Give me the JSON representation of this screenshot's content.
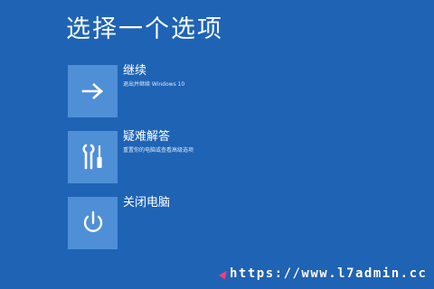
{
  "screen": {
    "title": "选择一个选项",
    "background": "#1f63b5",
    "tile_color": "#4f8fd6"
  },
  "options": [
    {
      "label": "继续",
      "description": "退出并继续 Windows 10",
      "icon": "arrow-right-icon"
    },
    {
      "label": "疑难解答",
      "description": "重置你的电脑或查看高级选项",
      "icon": "tools-icon"
    },
    {
      "label": "关闭电脑",
      "description": "",
      "icon": "power-icon"
    }
  ],
  "watermark": {
    "text": "https://www.l7admin.cc",
    "accent": "#ff3b7a"
  }
}
